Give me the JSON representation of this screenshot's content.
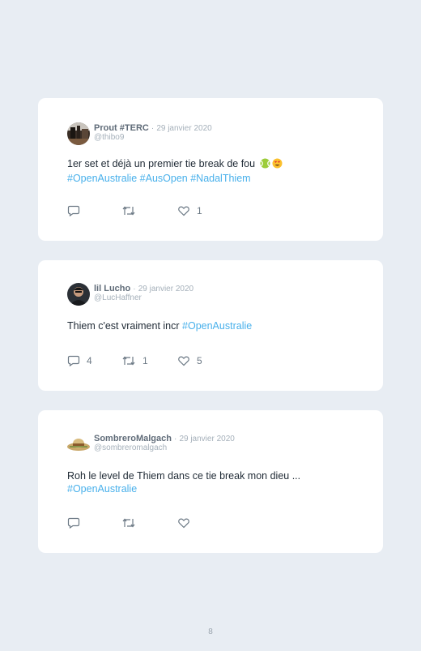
{
  "tweets": [
    {
      "name": "Prout #TERC",
      "separator": "·",
      "date": "29 janvier 2020",
      "handle": "@thibo9",
      "text": "1er set et déjà un premier tie break de fou",
      "hashtags": [
        "#OpenAustralie",
        "#AusOpen",
        "#NadalThiem"
      ],
      "emojis": [
        "tennis-ball",
        "heart-eyes"
      ],
      "replies": "",
      "retweets": "",
      "likes": "1"
    },
    {
      "name": "lil Lucho",
      "separator": "·",
      "date": "29 janvier 2020",
      "handle": "@LucHaffner",
      "text": "Thiem c'est vraiment incr",
      "hashtags": [
        "#OpenAustralie"
      ],
      "replies": "4",
      "retweets": "1",
      "likes": "5"
    },
    {
      "name": "SombreroMalgach",
      "separator": "·",
      "date": "29 janvier 2020",
      "handle": "@sombreromalgach",
      "text": "Roh le level de Thiem dans ce tie break mon dieu ...",
      "hashtags": [
        "#OpenAustralie"
      ],
      "replies": "",
      "retweets": "",
      "likes": ""
    }
  ],
  "page_number": "8",
  "colors": {
    "background": "#e8edf3",
    "card": "#ffffff",
    "hashtag": "#48b0eb",
    "name": "#5f6b78",
    "muted": "#a5b0ba",
    "icon": "#6b7884"
  }
}
